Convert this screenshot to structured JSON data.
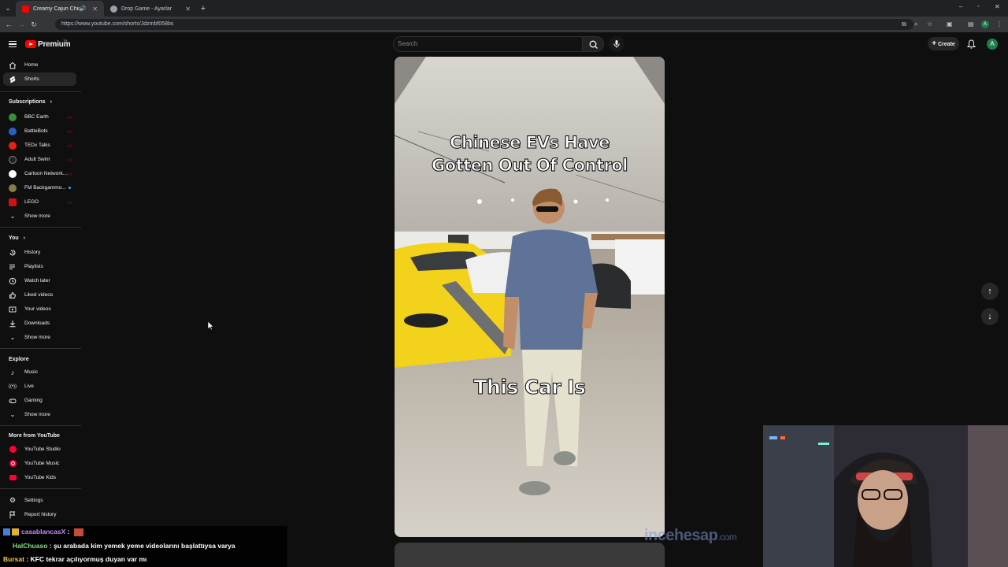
{
  "browser": {
    "tabs": [
      {
        "title": "Creamy Cajun Chicken Past",
        "active": true,
        "favicon_color": "#ff0000"
      },
      {
        "title": "Drop Game - Ayarlar",
        "active": false,
        "favicon_color": "#9aa0a6"
      }
    ],
    "url": "https://www.youtube.com/shorts/Jdzmbf058bs"
  },
  "header": {
    "brand": "Premium",
    "tm": "TR",
    "search_placeholder": "Search",
    "create_label": "Create",
    "avatar_letter": "A"
  },
  "sidebar": {
    "main": [
      {
        "label": "Home",
        "icon": "home-icon"
      },
      {
        "label": "Shorts",
        "icon": "shorts-icon",
        "active": true
      }
    ],
    "subscriptions_heading": "Subscriptions",
    "subscriptions": [
      {
        "label": "BBC Earth",
        "color": "#3b8e3b",
        "live": true
      },
      {
        "label": "BattleBots",
        "color": "#2b5fbf",
        "live": true
      },
      {
        "label": "TEDx Talks",
        "color": "#e62117",
        "live": true
      },
      {
        "label": "Adult Swim",
        "color": "#222222",
        "live": true
      },
      {
        "label": "Cartoon Network...",
        "color": "#ffffff",
        "live": true
      },
      {
        "label": "FM Backgammo...",
        "color": "#8a7a4a",
        "live": false
      },
      {
        "label": "LEGO",
        "color": "#d01012",
        "live": true
      }
    ],
    "subs_show_more": "Show more",
    "you_heading": "You",
    "you": [
      {
        "label": "History",
        "icon": "history-icon"
      },
      {
        "label": "Playlists",
        "icon": "playlists-icon"
      },
      {
        "label": "Watch later",
        "icon": "watch-later-icon"
      },
      {
        "label": "Liked videos",
        "icon": "thumbs-up-icon"
      },
      {
        "label": "Your videos",
        "icon": "your-videos-icon"
      },
      {
        "label": "Downloads",
        "icon": "download-icon"
      },
      {
        "label": "Show more",
        "icon": "chevron-down-icon"
      }
    ],
    "explore_heading": "Explore",
    "explore": [
      {
        "label": "Music",
        "icon": "music-icon"
      },
      {
        "label": "Live",
        "icon": "live-icon"
      },
      {
        "label": "Gaming",
        "icon": "gaming-icon"
      },
      {
        "label": "Show more",
        "icon": "chevron-down-icon"
      }
    ],
    "more_heading": "More from YouTube",
    "more": [
      {
        "label": "YouTube Studio",
        "icon": "youtube-studio-icon"
      },
      {
        "label": "YouTube Music",
        "icon": "youtube-music-icon"
      },
      {
        "label": "YouTube Kids",
        "icon": "youtube-kids-icon"
      }
    ],
    "footer": [
      {
        "label": "Settings",
        "icon": "gear-icon"
      },
      {
        "label": "Report history",
        "icon": "flag-icon"
      }
    ]
  },
  "video": {
    "caption_top_line1": "Chinese EVs Have",
    "caption_top_line2": "Gotten Out Of Control",
    "caption_bottom": "This Car Is"
  },
  "overlay": {
    "watermark_main": "incehesap",
    "watermark_tld": ".com",
    "chat": [
      {
        "user": "casablancasX",
        "text": ":",
        "user_color": "#c58af9"
      },
      {
        "user": "HalChuaso",
        "text": ": şu arabada kim yemek yeme videolarını başlattıysa varya",
        "user_color": "#7ee07e"
      },
      {
        "user": "Bursat",
        "text": ": KFC tekrar açılıyormuş duyan var mı",
        "user_color": "#f2c94c"
      }
    ]
  }
}
